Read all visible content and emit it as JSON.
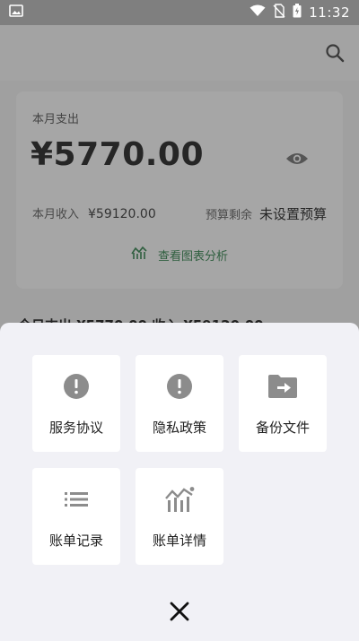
{
  "status_bar": {
    "time": "11:32",
    "icons": [
      "image-icon",
      "wifi-icon",
      "no-sim-icon",
      "battery-charging-icon"
    ]
  },
  "app_bar": {
    "icons": [
      "search-icon"
    ]
  },
  "summary": {
    "label": "本月支出",
    "amount": "¥5770.00",
    "income_label": "本月收入",
    "income_value": "¥59120.00",
    "budget_label": "预算剩余",
    "budget_value": "未设置预算",
    "chart_link": "查看图表分析"
  },
  "month_line": "今日支出 ¥5770.00 收入 ¥59120.00",
  "sheet": {
    "tiles": [
      {
        "label": "服务协议",
        "icon": "info-circle-icon"
      },
      {
        "label": "隐私政策",
        "icon": "info-circle-icon"
      },
      {
        "label": "备份文件",
        "icon": "folder-export-icon"
      },
      {
        "label": "账单记录",
        "icon": "list-icon"
      },
      {
        "label": "账单详情",
        "icon": "bar-chart-icon"
      }
    ],
    "close_icon": "close-icon"
  },
  "colors": {
    "accent_green": "#2f5f3f",
    "sheet_bg": "#f1f1f6",
    "tile_icon_gray": "#8c8c8c"
  }
}
